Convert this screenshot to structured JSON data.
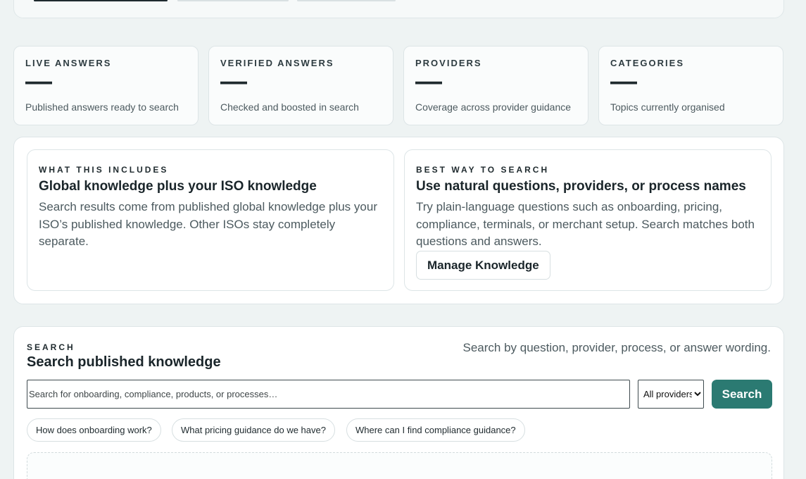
{
  "stats": [
    {
      "label": "LIVE ANSWERS",
      "value": "—",
      "desc": "Published answers ready to search"
    },
    {
      "label": "VERIFIED ANSWERS",
      "value": "—",
      "desc": "Checked and boosted in search"
    },
    {
      "label": "PROVIDERS",
      "value": "—",
      "desc": "Coverage across provider guidance"
    },
    {
      "label": "CATEGORIES",
      "value": "—",
      "desc": "Topics currently organised"
    }
  ],
  "includes": {
    "eyebrow": "WHAT THIS INCLUDES",
    "title": "Global knowledge plus your ISO knowledge",
    "body": "Search results come from published global knowledge plus your ISO’s published knowledge. Other ISOs stay completely separate."
  },
  "best_way": {
    "eyebrow": "BEST WAY TO SEARCH",
    "title": "Use natural questions, providers, or process names",
    "body": "Try plain-language questions such as onboarding, pricing, compliance, terminals, or merchant setup. Search matches both questions and answers.",
    "button_label": "Manage Knowledge"
  },
  "search": {
    "eyebrow": "SEARCH",
    "title": "Search published knowledge",
    "hint": "Search by question, provider, process, or answer wording.",
    "placeholder": "Search for onboarding, compliance, products, or processes…",
    "provider_selected": "All providers",
    "button_label": "Search",
    "suggestions": [
      "How does onboarding work?",
      "What pricing guidance do we have?",
      "Where can I find compliance guidance?"
    ]
  },
  "colors": {
    "accent": "#2b7a72",
    "background": "#eef3f3"
  }
}
